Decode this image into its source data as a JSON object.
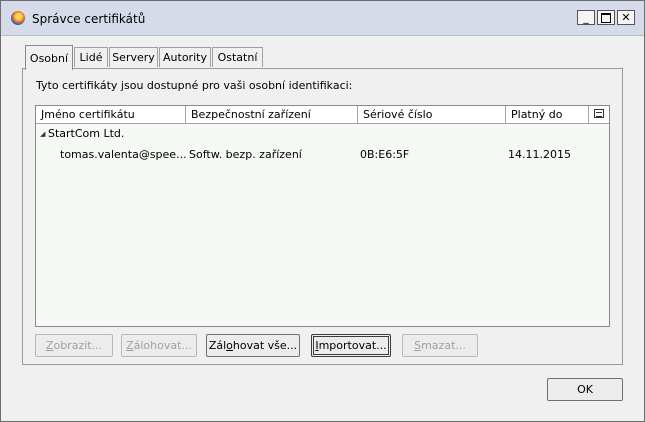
{
  "window": {
    "title": "Správce certifikátů"
  },
  "tabs": [
    {
      "label": "Osobní",
      "active": true
    },
    {
      "label": "Lidé",
      "active": false
    },
    {
      "label": "Servery",
      "active": false
    },
    {
      "label": "Autority",
      "active": false
    },
    {
      "label": "Ostatní",
      "active": false
    }
  ],
  "panel": {
    "description": "Tyto certifikáty jsou dostupné pro vaši osobní identifikaci:"
  },
  "table": {
    "columns": [
      "Jméno certifikátu",
      "Bezpečnostní zařízení",
      "Sériové číslo",
      "Platný do"
    ],
    "groups": [
      {
        "name": "StartCom Ltd.",
        "rows": [
          {
            "name": "tomas.valenta@spee...",
            "device": "Softw. bezp. zařízení",
            "serial": "0B:E6:5F",
            "expires": "14.11.2015"
          }
        ]
      }
    ]
  },
  "buttons": {
    "view": {
      "pre": "",
      "key": "Z",
      "post": "obrazit..."
    },
    "backup": {
      "pre": "",
      "key": "Z",
      "post": "álohovat..."
    },
    "backup_all": {
      "pre": "Zál",
      "key": "o",
      "post": "hovat vše..."
    },
    "import": {
      "pre": "",
      "key": "I",
      "post": "mportovat..."
    },
    "delete": {
      "pre": "",
      "key": "S",
      "post": "mazat..."
    },
    "ok": "OK"
  }
}
